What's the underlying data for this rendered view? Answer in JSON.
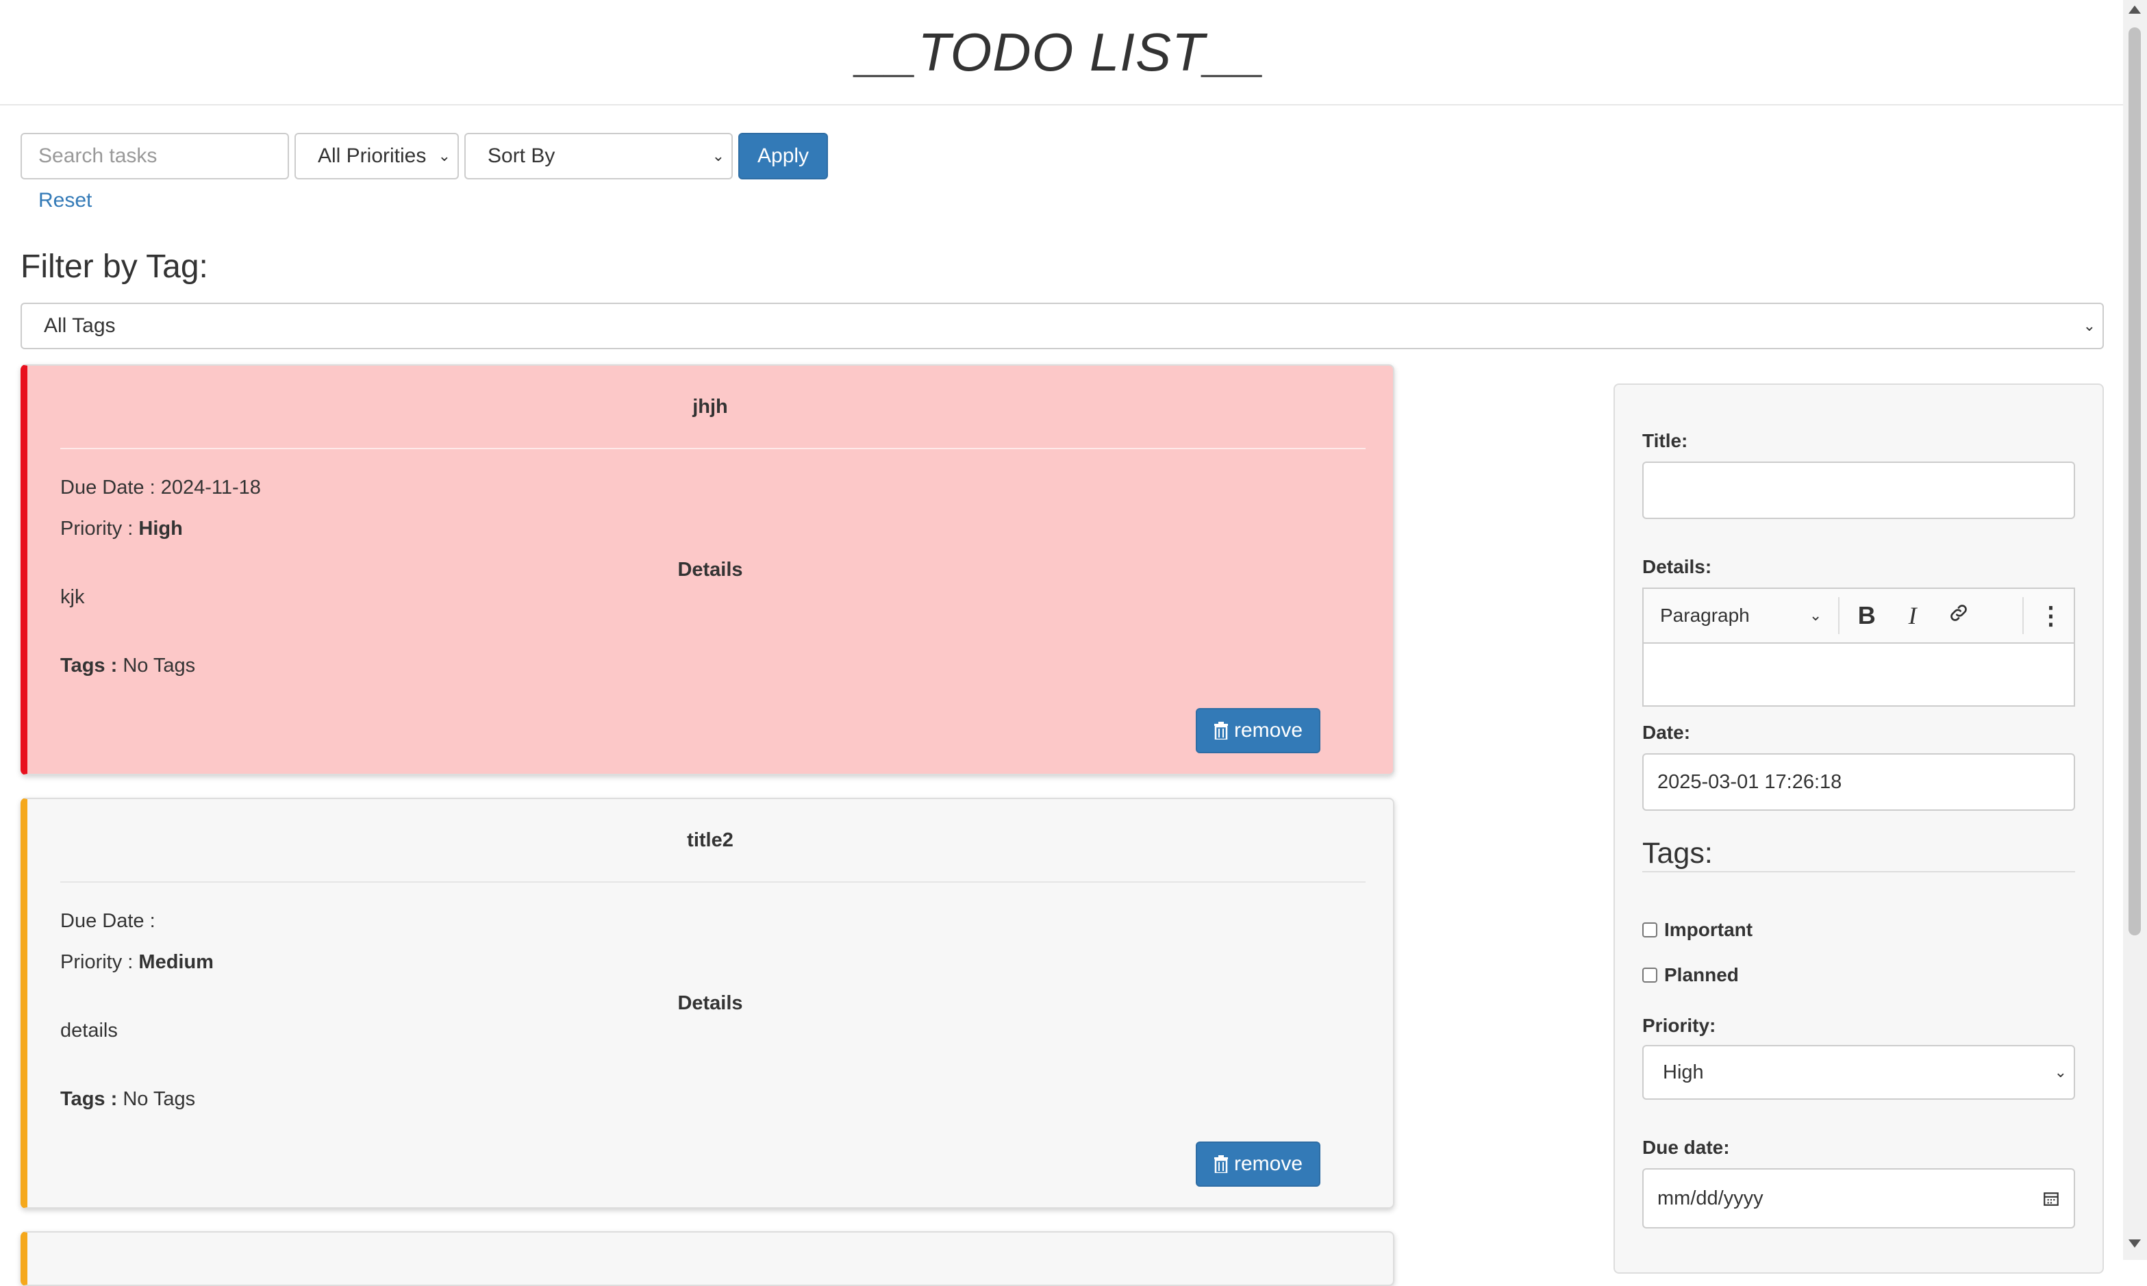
{
  "header": {
    "title": "__TODO LIST__"
  },
  "toolbar": {
    "search_placeholder": "Search tasks",
    "priority_select": "All Priorities",
    "sort_select": "Sort By",
    "apply_label": "Apply",
    "reset_label": "Reset"
  },
  "tag_filter": {
    "heading": "Filter by Tag:",
    "selected": "All Tags"
  },
  "tasks": [
    {
      "title": "jhjh",
      "due_label": "Due Date :",
      "due_value": "2024-11-18",
      "priority_label": "Priority :",
      "priority_value": "High",
      "details_heading": "Details",
      "details": "kjk",
      "tags_label": "Tags :",
      "tags_value": "No Tags",
      "remove_label": "remove",
      "accent": "#e8101e",
      "background": "#fcc8c8"
    },
    {
      "title": "title2",
      "due_label": "Due Date :",
      "due_value": "",
      "priority_label": "Priority :",
      "priority_value": "Medium",
      "details_heading": "Details",
      "details": "details",
      "tags_label": "Tags :",
      "tags_value": "No Tags",
      "remove_label": "remove",
      "accent": "#f5a81c",
      "background": "#f7f7f7"
    }
  ],
  "form": {
    "title_label": "Title:",
    "title_value": "",
    "details_label": "Details:",
    "editor_block": "Paragraph",
    "date_label": "Date:",
    "date_value": "2025-03-01 17:26:18",
    "tags_heading": "Tags:",
    "tag_options": [
      "Important",
      "Planned"
    ],
    "priority_label": "Priority:",
    "priority_value": "High",
    "due_label": "Due date:",
    "due_placeholder": "mm/dd/yyyy"
  },
  "icons": {
    "bold": "bold-icon",
    "italic": "italic-icon",
    "link": "link-icon",
    "more": "more-vertical-icon",
    "calendar": "calendar-icon",
    "trash": "trash-icon"
  }
}
